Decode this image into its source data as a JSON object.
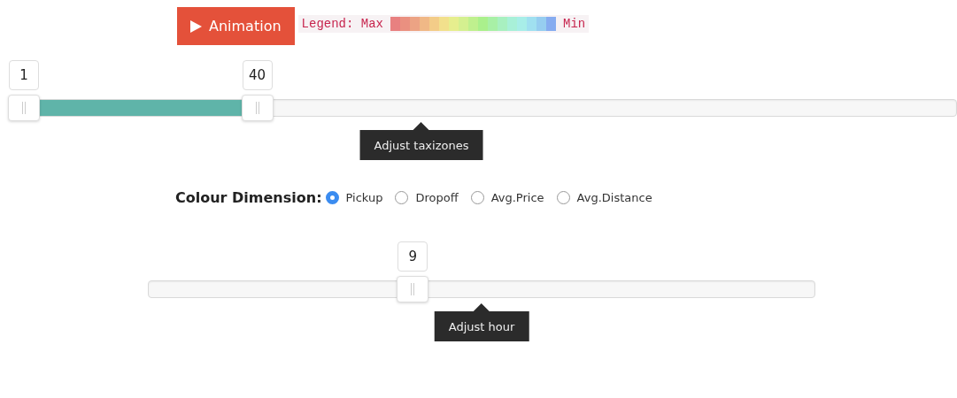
{
  "toolbar": {
    "animation_button": "Animation",
    "legend": {
      "label": "Legend: Max",
      "end_label": "Min"
    }
  },
  "zone_slider": {
    "handles": [
      {
        "value": "1",
        "level": 0.016
      },
      {
        "value": "40",
        "level": 0.262
      }
    ],
    "tooltip": "Adjust taxizones"
  },
  "colour_dimension": {
    "label": "Colour Dimension:",
    "options": [
      {
        "label": "Pickup",
        "selected": true
      },
      {
        "label": "Dropoff",
        "selected": false
      },
      {
        "label": "Avg.Price",
        "selected": false
      },
      {
        "label": "Avg.Distance",
        "selected": false
      }
    ]
  },
  "hour_slider": {
    "handles": [
      {
        "value": "9",
        "level": 0.397
      }
    ],
    "tooltip": "Adjust hour"
  }
}
